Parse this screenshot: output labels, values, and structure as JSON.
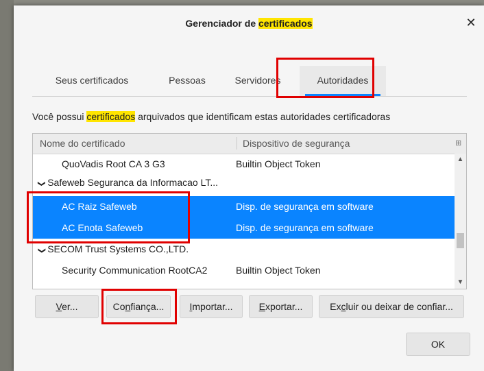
{
  "dialog": {
    "title_prefix": "Gerenciador de ",
    "title_highlight": "certificados",
    "close_glyph": "✕"
  },
  "tabs": [
    {
      "label": "Seus certificados",
      "active": false
    },
    {
      "label": "Pessoas",
      "active": false
    },
    {
      "label": "Servidores",
      "active": false
    },
    {
      "label": "Autoridades",
      "active": true
    }
  ],
  "description": {
    "before": "Você possui ",
    "highlight": "certificados",
    "after": " arquivados que identificam estas autoridades certificadoras"
  },
  "tree": {
    "columns": [
      "Nome do certificado",
      "Dispositivo de segurança"
    ],
    "rows": [
      {
        "type": "cert",
        "name": "QuoVadis Root CA 3 G3",
        "device": "Builtin Object Token",
        "selected": false
      },
      {
        "type": "group",
        "name": "Safeweb Seguranca da Informacao LT...",
        "expanded": true
      },
      {
        "type": "cert",
        "name": "AC Raiz Safeweb",
        "device": "Disp. de segurança em software",
        "selected": true
      },
      {
        "type": "cert",
        "name": "AC Enota Safeweb",
        "device": "Disp. de segurança em software",
        "selected": true
      },
      {
        "type": "group",
        "name": "SECOM Trust Systems CO.,LTD.",
        "expanded": true
      },
      {
        "type": "cert",
        "name": "Security Communication RootCA2",
        "device": "Builtin Object Token",
        "selected": false
      }
    ]
  },
  "buttons": {
    "view": {
      "accel": "V",
      "rest": "er..."
    },
    "trust": {
      "pre": "Co",
      "accel": "n",
      "rest": "fiança..."
    },
    "import": {
      "accel": "I",
      "rest": "mportar..."
    },
    "export": {
      "accel": "E",
      "rest": "xportar..."
    },
    "delete": {
      "pre": "Ex",
      "accel": "c",
      "rest": "luir ou deixar de confiar..."
    },
    "ok": "OK"
  },
  "colors": {
    "highlight": "#ffe500",
    "selection": "#0a84ff",
    "annotation_red": "#e00000"
  }
}
